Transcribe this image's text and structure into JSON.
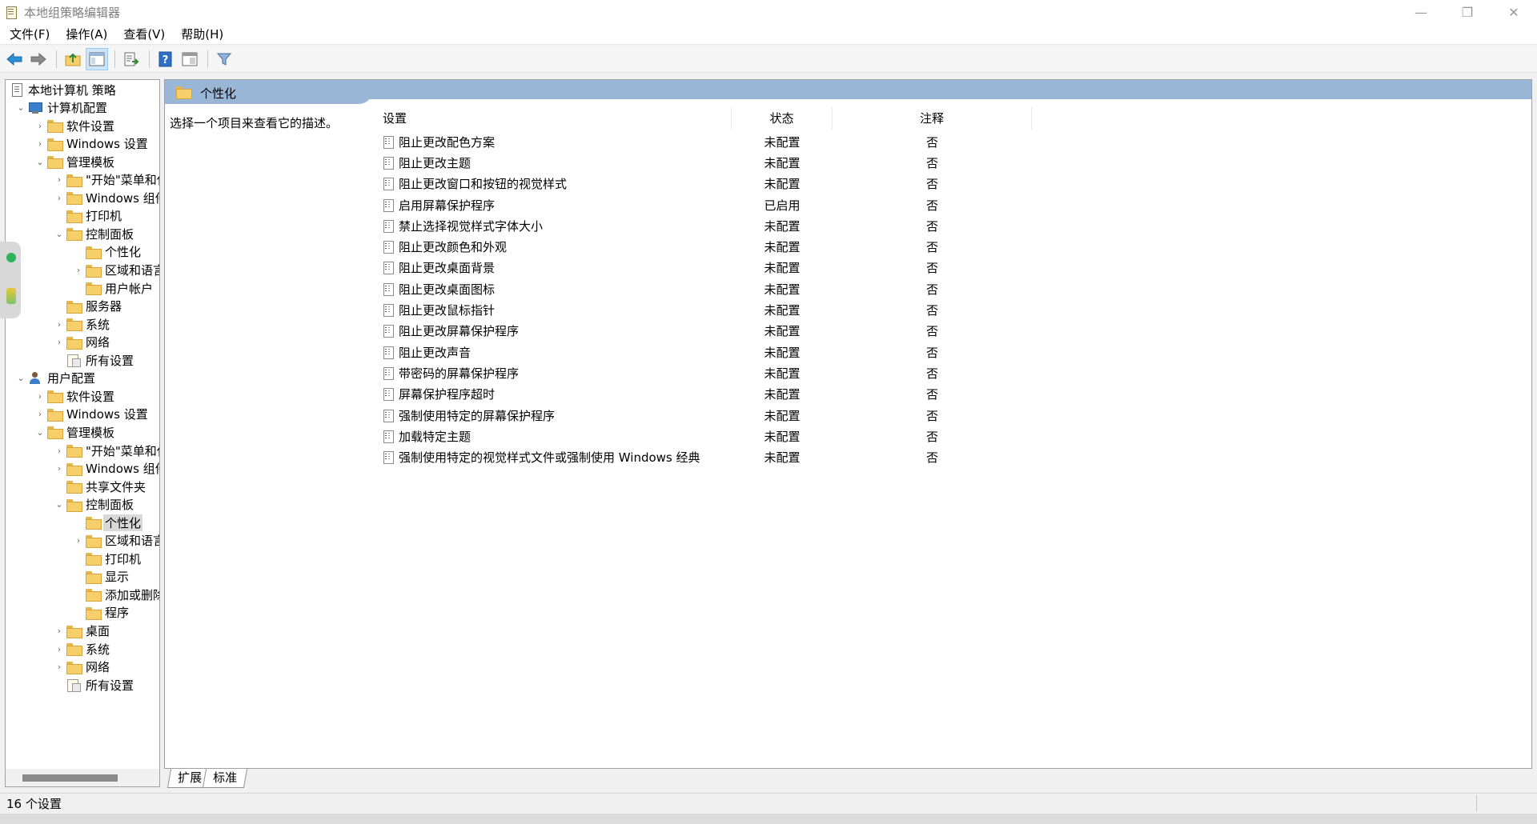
{
  "window": {
    "title": "本地组策略编辑器",
    "controls": {
      "minimize": "—",
      "restore": "❐",
      "close": "✕"
    }
  },
  "menu": [
    "文件(F)",
    "操作(A)",
    "查看(V)",
    "帮助(H)"
  ],
  "toolbar": {
    "buttons": [
      "back-icon",
      "forward-icon",
      "up-folder-icon",
      "show-hide-tree-icon",
      "export-list-icon",
      "help-icon",
      "properties-view-icon",
      "filter-icon"
    ]
  },
  "tree": [
    {
      "label": "本地计算机 策略",
      "depth": 0,
      "icon": "doc",
      "chev": ""
    },
    {
      "label": "计算机配置",
      "depth": 1,
      "icon": "pc",
      "chev": "⌄"
    },
    {
      "label": "软件设置",
      "depth": 2,
      "icon": "folder",
      "chev": "›"
    },
    {
      "label": "Windows 设置",
      "depth": 2,
      "icon": "folder",
      "chev": "›"
    },
    {
      "label": "管理模板",
      "depth": 2,
      "icon": "folder",
      "chev": "⌄"
    },
    {
      "label": "\"开始\"菜单和任务栏",
      "depth": 3,
      "icon": "folder",
      "chev": "›"
    },
    {
      "label": "Windows 组件",
      "depth": 3,
      "icon": "folder",
      "chev": "›"
    },
    {
      "label": "打印机",
      "depth": 3,
      "icon": "folder",
      "chev": ""
    },
    {
      "label": "控制面板",
      "depth": 3,
      "icon": "folder",
      "chev": "⌄"
    },
    {
      "label": "个性化",
      "depth": 4,
      "icon": "folder",
      "chev": ""
    },
    {
      "label": "区域和语言",
      "depth": 4,
      "icon": "folder",
      "chev": "›"
    },
    {
      "label": "用户帐户",
      "depth": 4,
      "icon": "folder",
      "chev": ""
    },
    {
      "label": "服务器",
      "depth": 3,
      "icon": "folder",
      "chev": ""
    },
    {
      "label": "系统",
      "depth": 3,
      "icon": "folder",
      "chev": "›"
    },
    {
      "label": "网络",
      "depth": 3,
      "icon": "folder",
      "chev": "›"
    },
    {
      "label": "所有设置",
      "depth": 3,
      "icon": "allset",
      "chev": ""
    },
    {
      "label": "用户配置",
      "depth": 1,
      "icon": "user",
      "chev": "⌄"
    },
    {
      "label": "软件设置",
      "depth": 2,
      "icon": "folder",
      "chev": "›"
    },
    {
      "label": "Windows 设置",
      "depth": 2,
      "icon": "folder",
      "chev": "›"
    },
    {
      "label": "管理模板",
      "depth": 2,
      "icon": "folder",
      "chev": "⌄"
    },
    {
      "label": "\"开始\"菜单和任务栏",
      "depth": 3,
      "icon": "folder",
      "chev": "›"
    },
    {
      "label": "Windows 组件",
      "depth": 3,
      "icon": "folder",
      "chev": "›"
    },
    {
      "label": "共享文件夹",
      "depth": 3,
      "icon": "folder",
      "chev": ""
    },
    {
      "label": "控制面板",
      "depth": 3,
      "icon": "folder",
      "chev": "⌄"
    },
    {
      "label": "个性化",
      "depth": 4,
      "icon": "folder",
      "chev": "",
      "selected": true
    },
    {
      "label": "区域和语言",
      "depth": 4,
      "icon": "folder",
      "chev": "›"
    },
    {
      "label": "打印机",
      "depth": 4,
      "icon": "folder",
      "chev": ""
    },
    {
      "label": "显示",
      "depth": 4,
      "icon": "folder",
      "chev": ""
    },
    {
      "label": "添加或删除程序",
      "depth": 4,
      "icon": "folder",
      "chev": ""
    },
    {
      "label": "程序",
      "depth": 4,
      "icon": "folder",
      "chev": ""
    },
    {
      "label": "桌面",
      "depth": 3,
      "icon": "folder",
      "chev": "›"
    },
    {
      "label": "系统",
      "depth": 3,
      "icon": "folder",
      "chev": "›"
    },
    {
      "label": "网络",
      "depth": 3,
      "icon": "folder",
      "chev": "›"
    },
    {
      "label": "所有设置",
      "depth": 3,
      "icon": "allset",
      "chev": ""
    }
  ],
  "content": {
    "header_title": "个性化",
    "description": "选择一个项目来查看它的描述。",
    "columns": {
      "setting": "设置",
      "state": "状态",
      "note": "注释"
    },
    "rows": [
      {
        "setting": "阻止更改配色方案",
        "state": "未配置",
        "note": "否"
      },
      {
        "setting": "阻止更改主题",
        "state": "未配置",
        "note": "否"
      },
      {
        "setting": "阻止更改窗口和按钮的视觉样式",
        "state": "未配置",
        "note": "否"
      },
      {
        "setting": "启用屏幕保护程序",
        "state": "已启用",
        "note": "否"
      },
      {
        "setting": "禁止选择视觉样式字体大小",
        "state": "未配置",
        "note": "否"
      },
      {
        "setting": "阻止更改颜色和外观",
        "state": "未配置",
        "note": "否"
      },
      {
        "setting": "阻止更改桌面背景",
        "state": "未配置",
        "note": "否"
      },
      {
        "setting": "阻止更改桌面图标",
        "state": "未配置",
        "note": "否"
      },
      {
        "setting": "阻止更改鼠标指针",
        "state": "未配置",
        "note": "否"
      },
      {
        "setting": "阻止更改屏幕保护程序",
        "state": "未配置",
        "note": "否"
      },
      {
        "setting": "阻止更改声音",
        "state": "未配置",
        "note": "否"
      },
      {
        "setting": "带密码的屏幕保护程序",
        "state": "未配置",
        "note": "否"
      },
      {
        "setting": "屏幕保护程序超时",
        "state": "未配置",
        "note": "否"
      },
      {
        "setting": "强制使用特定的屏幕保护程序",
        "state": "未配置",
        "note": "否"
      },
      {
        "setting": "加载特定主题",
        "state": "未配置",
        "note": "否"
      },
      {
        "setting": "强制使用特定的视觉样式文件或强制使用 Windows 经典",
        "state": "未配置",
        "note": "否"
      }
    ]
  },
  "bottom_tabs": [
    "扩展",
    "标准"
  ],
  "status": {
    "text": "16 个设置"
  }
}
